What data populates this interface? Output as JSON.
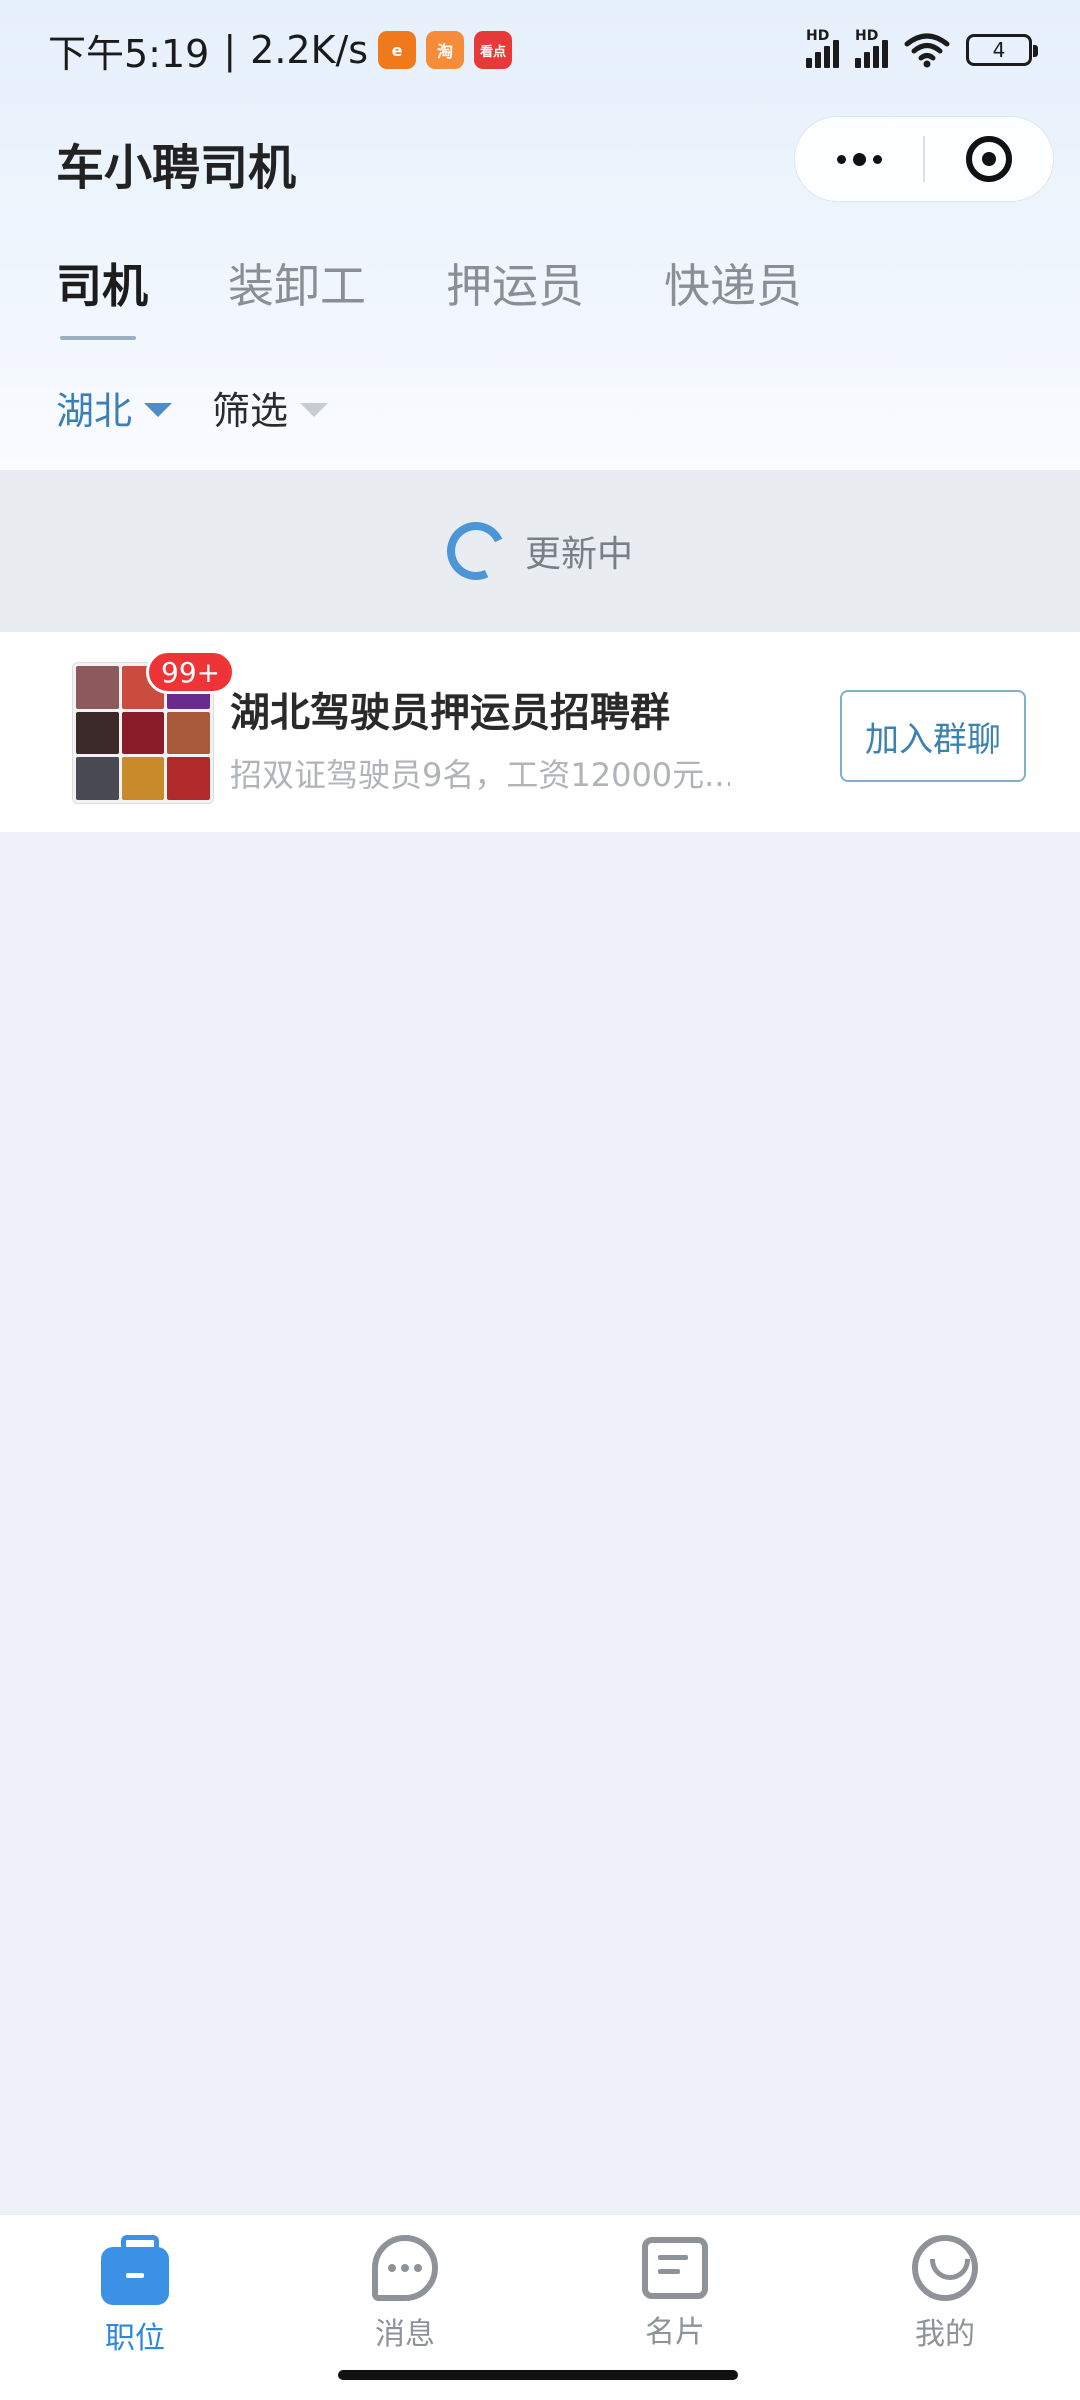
{
  "status_bar": {
    "time": "下午5:19",
    "speed": "2.2K/s",
    "app_icons": [
      {
        "name": "taobao-live-icon",
        "color": "#f07a1b",
        "text": "e"
      },
      {
        "name": "taobao-icon",
        "color": "#f58c3a",
        "text": "淘"
      },
      {
        "name": "kandian-icon",
        "color": "#e8393a",
        "text": "看点"
      }
    ],
    "signal_label": "HD",
    "battery": "4"
  },
  "nav": {
    "title": "车小聘司机"
  },
  "tabs": [
    {
      "label": "司机",
      "active": true
    },
    {
      "label": "装卸工",
      "active": false
    },
    {
      "label": "押运员",
      "active": false
    },
    {
      "label": "快递员",
      "active": false
    }
  ],
  "filters": {
    "region": "湖北",
    "screen": "筛选"
  },
  "refresh": {
    "text": "更新中"
  },
  "group_card": {
    "badge": "99+",
    "title": "湖北驾驶员押运员招聘群",
    "description": "招双证驾驶员9名，工资12000元...",
    "join_label": "加入群聊",
    "avatar_colors": [
      "#8c5a5a",
      "#c94c3f",
      "#6a2c8c",
      "#3c2a2a",
      "#8a1c2a",
      "#a85a3a",
      "#4a4a52",
      "#c98a2a",
      "#b02a2a"
    ]
  },
  "tabbar": [
    {
      "label": "职位",
      "icon": "briefcase-icon",
      "active": true
    },
    {
      "label": "消息",
      "icon": "message-icon",
      "active": false
    },
    {
      "label": "名片",
      "icon": "card-icon",
      "active": false
    },
    {
      "label": "我的",
      "icon": "profile-icon",
      "active": false
    }
  ]
}
